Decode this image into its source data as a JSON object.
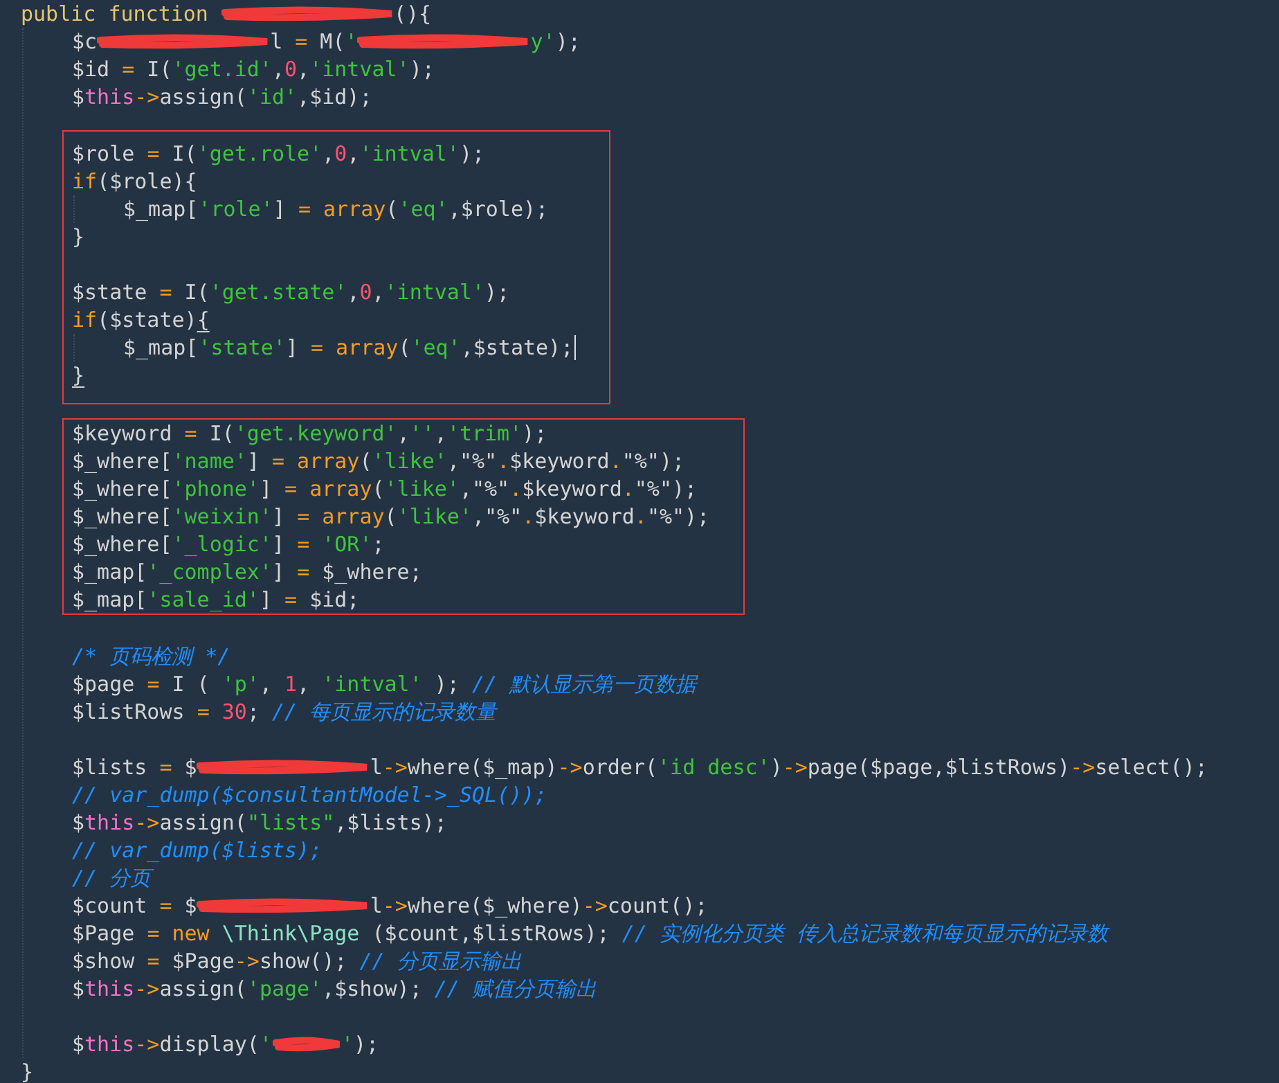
{
  "code": [
    {
      "tokens": [
        {
          "kind": "decl",
          "text": "public function "
        },
        {
          "kind": "redact-long"
        },
        {
          "kind": "plain",
          "text": "(){"
        }
      ],
      "children": [
        {
          "tokens": [
            {
              "kind": "plain",
              "text": "$c"
            },
            {
              "kind": "redact-long"
            },
            {
              "kind": "plain",
              "text": "l "
            },
            {
              "kind": "op",
              "text": "="
            },
            {
              "kind": "plain",
              "text": " M("
            },
            {
              "kind": "str",
              "text": "'"
            },
            {
              "kind": "redact-long"
            },
            {
              "kind": "str",
              "text": "y'"
            },
            {
              "kind": "plain",
              "text": ");"
            }
          ]
        },
        {
          "tokens": [
            {
              "kind": "plain",
              "text": "$id "
            },
            {
              "kind": "op",
              "text": "="
            },
            {
              "kind": "plain",
              "text": " I("
            },
            {
              "kind": "str",
              "text": "'get.id'"
            },
            {
              "kind": "plain",
              "text": ","
            },
            {
              "kind": "num",
              "text": "0"
            },
            {
              "kind": "plain",
              "text": ","
            },
            {
              "kind": "str",
              "text": "'intval'"
            },
            {
              "kind": "plain",
              "text": ");"
            }
          ]
        },
        {
          "tokens": [
            {
              "kind": "plain",
              "text": "$"
            },
            {
              "kind": "this",
              "text": "this"
            },
            {
              "kind": "op",
              "text": "->"
            },
            {
              "kind": "plain",
              "text": "assign("
            },
            {
              "kind": "str",
              "text": "'id'"
            },
            {
              "kind": "plain",
              "text": ",$id);"
            }
          ]
        },
        {
          "kind": "blank"
        },
        {
          "kind": "group",
          "boxed": true,
          "lines": [
            {
              "tokens": [
                {
                  "kind": "plain",
                  "text": "$role "
                },
                {
                  "kind": "op",
                  "text": "="
                },
                {
                  "kind": "plain",
                  "text": " I("
                },
                {
                  "kind": "str",
                  "text": "'get.role'"
                },
                {
                  "kind": "plain",
                  "text": ","
                },
                {
                  "kind": "num",
                  "text": "0"
                },
                {
                  "kind": "plain",
                  "text": ","
                },
                {
                  "kind": "str",
                  "text": "'intval'"
                },
                {
                  "kind": "plain",
                  "text": ");"
                }
              ]
            },
            {
              "tokens": [
                {
                  "kind": "op",
                  "text": "if"
                },
                {
                  "kind": "plain",
                  "text": "($role){"
                }
              ],
              "children": [
                {
                  "tokens": [
                    {
                      "kind": "plain",
                      "text": "$_map["
                    },
                    {
                      "kind": "str",
                      "text": "'role'"
                    },
                    {
                      "kind": "plain",
                      "text": "] "
                    },
                    {
                      "kind": "op",
                      "text": "= array"
                    },
                    {
                      "kind": "plain",
                      "text": "("
                    },
                    {
                      "kind": "str",
                      "text": "'eq'"
                    },
                    {
                      "kind": "plain",
                      "text": ",$role);"
                    }
                  ]
                }
              ]
            },
            {
              "tokens": [
                {
                  "kind": "plain",
                  "text": "}"
                }
              ]
            },
            {
              "kind": "blank"
            },
            {
              "tokens": [
                {
                  "kind": "plain",
                  "text": "$state "
                },
                {
                  "kind": "op",
                  "text": "="
                },
                {
                  "kind": "plain",
                  "text": " I("
                },
                {
                  "kind": "str",
                  "text": "'get.state'"
                },
                {
                  "kind": "plain",
                  "text": ","
                },
                {
                  "kind": "num",
                  "text": "0"
                },
                {
                  "kind": "plain",
                  "text": ","
                },
                {
                  "kind": "str",
                  "text": "'intval'"
                },
                {
                  "kind": "plain",
                  "text": ");"
                }
              ]
            },
            {
              "tokens": [
                {
                  "kind": "op",
                  "text": "if"
                },
                {
                  "kind": "plain",
                  "text": "($state)"
                },
                {
                  "kind": "plain",
                  "text": "{",
                  "matched": true
                }
              ],
              "children": [
                {
                  "cursor": true,
                  "tokens": [
                    {
                      "kind": "plain",
                      "text": "$_map["
                    },
                    {
                      "kind": "str",
                      "text": "'state'"
                    },
                    {
                      "kind": "plain",
                      "text": "] "
                    },
                    {
                      "kind": "op",
                      "text": "= array"
                    },
                    {
                      "kind": "plain",
                      "text": "("
                    },
                    {
                      "kind": "str",
                      "text": "'eq'"
                    },
                    {
                      "kind": "plain",
                      "text": ",$state);"
                    }
                  ]
                }
              ]
            },
            {
              "tokens": [
                {
                  "kind": "plain",
                  "text": "}",
                  "matched": true
                }
              ]
            }
          ]
        },
        {
          "kind": "group",
          "boxed": true,
          "lines": [
            {
              "tokens": [
                {
                  "kind": "plain",
                  "text": "$keyword "
                },
                {
                  "kind": "op",
                  "text": "="
                },
                {
                  "kind": "plain",
                  "text": " I("
                },
                {
                  "kind": "str",
                  "text": "'get.keyword'"
                },
                {
                  "kind": "plain",
                  "text": ","
                },
                {
                  "kind": "str",
                  "text": "''"
                },
                {
                  "kind": "plain",
                  "text": ","
                },
                {
                  "kind": "str",
                  "text": "'trim'"
                },
                {
                  "kind": "plain",
                  "text": ");"
                }
              ]
            },
            {
              "tokens": [
                {
                  "kind": "plain",
                  "text": "$_where["
                },
                {
                  "kind": "str",
                  "text": "'name'"
                },
                {
                  "kind": "plain",
                  "text": "] "
                },
                {
                  "kind": "op",
                  "text": "= array"
                },
                {
                  "kind": "plain",
                  "text": "("
                },
                {
                  "kind": "str",
                  "text": "'like'"
                },
                {
                  "kind": "plain",
                  "text": ",\"%\""
                },
                {
                  "kind": "op",
                  "text": "."
                },
                {
                  "kind": "plain",
                  "text": "$keyword"
                },
                {
                  "kind": "op",
                  "text": "."
                },
                {
                  "kind": "plain",
                  "text": "\"%\");"
                }
              ]
            },
            {
              "tokens": [
                {
                  "kind": "plain",
                  "text": "$_where["
                },
                {
                  "kind": "str",
                  "text": "'phone'"
                },
                {
                  "kind": "plain",
                  "text": "] "
                },
                {
                  "kind": "op",
                  "text": "= array"
                },
                {
                  "kind": "plain",
                  "text": "("
                },
                {
                  "kind": "str",
                  "text": "'like'"
                },
                {
                  "kind": "plain",
                  "text": ",\"%\""
                },
                {
                  "kind": "op",
                  "text": "."
                },
                {
                  "kind": "plain",
                  "text": "$keyword"
                },
                {
                  "kind": "op",
                  "text": "."
                },
                {
                  "kind": "plain",
                  "text": "\"%\");"
                }
              ]
            },
            {
              "tokens": [
                {
                  "kind": "plain",
                  "text": "$_where["
                },
                {
                  "kind": "str",
                  "text": "'weixin'"
                },
                {
                  "kind": "plain",
                  "text": "] "
                },
                {
                  "kind": "op",
                  "text": "= array"
                },
                {
                  "kind": "plain",
                  "text": "("
                },
                {
                  "kind": "str",
                  "text": "'like'"
                },
                {
                  "kind": "plain",
                  "text": ",\"%\""
                },
                {
                  "kind": "op",
                  "text": "."
                },
                {
                  "kind": "plain",
                  "text": "$keyword"
                },
                {
                  "kind": "op",
                  "text": "."
                },
                {
                  "kind": "plain",
                  "text": "\"%\");"
                }
              ]
            },
            {
              "tokens": [
                {
                  "kind": "plain",
                  "text": "$_where["
                },
                {
                  "kind": "str",
                  "text": "'_logic'"
                },
                {
                  "kind": "plain",
                  "text": "] "
                },
                {
                  "kind": "op",
                  "text": "="
                },
                {
                  "kind": "str",
                  "text": " 'OR'"
                },
                {
                  "kind": "plain",
                  "text": ";"
                }
              ]
            },
            {
              "tokens": [
                {
                  "kind": "plain",
                  "text": "$_map["
                },
                {
                  "kind": "str",
                  "text": "'_complex'"
                },
                {
                  "kind": "plain",
                  "text": "] "
                },
                {
                  "kind": "op",
                  "text": "="
                },
                {
                  "kind": "plain",
                  "text": " $_where;"
                }
              ]
            },
            {
              "tokens": [
                {
                  "kind": "plain",
                  "text": "$_map["
                },
                {
                  "kind": "str",
                  "text": "'sale_id'"
                },
                {
                  "kind": "plain",
                  "text": "] "
                },
                {
                  "kind": "op",
                  "text": "="
                },
                {
                  "kind": "plain",
                  "text": " $id;"
                }
              ]
            }
          ]
        },
        {
          "kind": "blank"
        },
        {
          "tokens": [
            {
              "kind": "com",
              "text": "/* 页码检测 */"
            }
          ]
        },
        {
          "tokens": [
            {
              "kind": "plain",
              "text": "$page "
            },
            {
              "kind": "op",
              "text": "="
            },
            {
              "kind": "plain",
              "text": " I ( "
            },
            {
              "kind": "str",
              "text": "'p'"
            },
            {
              "kind": "plain",
              "text": ", "
            },
            {
              "kind": "num",
              "text": "1"
            },
            {
              "kind": "plain",
              "text": ", "
            },
            {
              "kind": "str",
              "text": "'intval'"
            },
            {
              "kind": "plain",
              "text": " ); "
            },
            {
              "kind": "com",
              "text": "// 默认显示第一页数据"
            }
          ]
        },
        {
          "tokens": [
            {
              "kind": "plain",
              "text": "$listRows "
            },
            {
              "kind": "op",
              "text": "="
            },
            {
              "kind": "num",
              "text": " 30"
            },
            {
              "kind": "plain",
              "text": "; "
            },
            {
              "kind": "com",
              "text": "// 每页显示的记录数量"
            }
          ]
        },
        {
          "kind": "blank"
        },
        {
          "tokens": [
            {
              "kind": "plain",
              "text": "$lists "
            },
            {
              "kind": "op",
              "text": "="
            },
            {
              "kind": "plain",
              "text": " $"
            },
            {
              "kind": "redact-long"
            },
            {
              "kind": "plain",
              "text": "l"
            },
            {
              "kind": "op",
              "text": "->"
            },
            {
              "kind": "plain",
              "text": "where($_map)"
            },
            {
              "kind": "op",
              "text": "->"
            },
            {
              "kind": "plain",
              "text": "order("
            },
            {
              "kind": "str",
              "text": "'id desc'"
            },
            {
              "kind": "plain",
              "text": ")"
            },
            {
              "kind": "op",
              "text": "->"
            },
            {
              "kind": "plain",
              "text": "page($page,$listRows)"
            },
            {
              "kind": "op",
              "text": "->"
            },
            {
              "kind": "plain",
              "text": "select();"
            }
          ]
        },
        {
          "tokens": [
            {
              "kind": "com",
              "text": "// var_dump($consultantModel->_SQL());"
            }
          ]
        },
        {
          "tokens": [
            {
              "kind": "plain",
              "text": "$"
            },
            {
              "kind": "this",
              "text": "this"
            },
            {
              "kind": "op",
              "text": "->"
            },
            {
              "kind": "plain",
              "text": "assign("
            },
            {
              "kind": "str",
              "text": "\"lists\""
            },
            {
              "kind": "plain",
              "text": ",$lists);"
            }
          ]
        },
        {
          "tokens": [
            {
              "kind": "com",
              "text": "// var_dump($lists);"
            }
          ]
        },
        {
          "tokens": [
            {
              "kind": "com",
              "text": "// 分页"
            }
          ]
        },
        {
          "tokens": [
            {
              "kind": "plain",
              "text": "$count "
            },
            {
              "kind": "op",
              "text": "="
            },
            {
              "kind": "plain",
              "text": " $"
            },
            {
              "kind": "redact-long"
            },
            {
              "kind": "plain",
              "text": "l"
            },
            {
              "kind": "op",
              "text": "->"
            },
            {
              "kind": "plain",
              "text": "where($_where)"
            },
            {
              "kind": "op",
              "text": "->"
            },
            {
              "kind": "plain",
              "text": "count();"
            }
          ]
        },
        {
          "tokens": [
            {
              "kind": "plain",
              "text": "$Page "
            },
            {
              "kind": "op",
              "text": "= new"
            },
            {
              "kind": "cls",
              "text": " \\Think\\Page"
            },
            {
              "kind": "plain",
              "text": " ($count,$listRows); "
            },
            {
              "kind": "com",
              "text": "// 实例化分页类 传入总记录数和每页显示的记录数"
            }
          ]
        },
        {
          "tokens": [
            {
              "kind": "plain",
              "text": "$show "
            },
            {
              "kind": "op",
              "text": "="
            },
            {
              "kind": "plain",
              "text": " $Page"
            },
            {
              "kind": "op",
              "text": "->"
            },
            {
              "kind": "plain",
              "text": "show(); "
            },
            {
              "kind": "com",
              "text": "// 分页显示输出"
            }
          ]
        },
        {
          "tokens": [
            {
              "kind": "plain",
              "text": "$"
            },
            {
              "kind": "this",
              "text": "this"
            },
            {
              "kind": "op",
              "text": "->"
            },
            {
              "kind": "plain",
              "text": "assign("
            },
            {
              "kind": "str",
              "text": "'page'"
            },
            {
              "kind": "plain",
              "text": ",$show); "
            },
            {
              "kind": "com",
              "text": "// 赋值分页输出"
            }
          ]
        },
        {
          "kind": "blank"
        },
        {
          "tokens": [
            {
              "kind": "plain",
              "text": "$"
            },
            {
              "kind": "this",
              "text": "this"
            },
            {
              "kind": "op",
              "text": "->"
            },
            {
              "kind": "plain",
              "text": "display("
            },
            {
              "kind": "str",
              "text": "'"
            },
            {
              "kind": "redact-short"
            },
            {
              "kind": "str",
              "text": "'"
            },
            {
              "kind": "plain",
              "text": ");"
            }
          ]
        }
      ]
    },
    {
      "tokens": [
        {
          "kind": "plain",
          "text": "}"
        }
      ]
    }
  ]
}
